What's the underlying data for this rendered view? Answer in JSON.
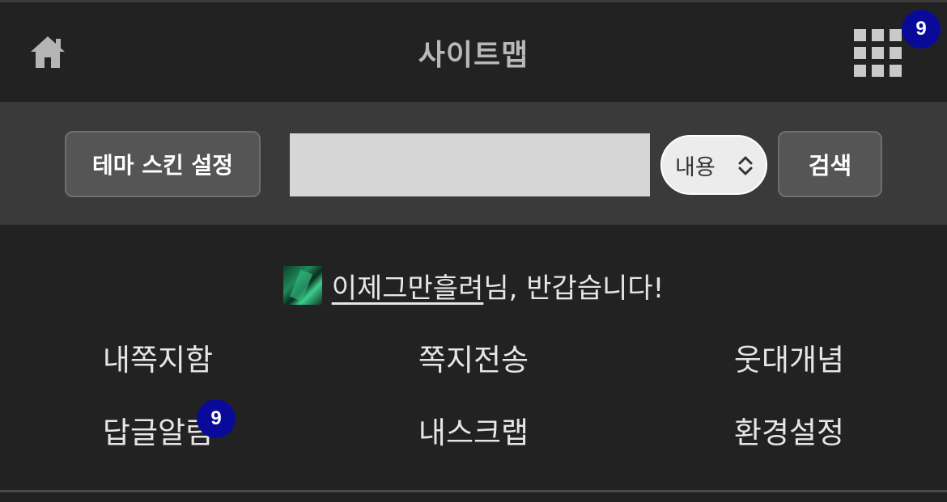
{
  "header": {
    "title": "사이트맵",
    "home_icon": "home-icon",
    "apps_icon": "grid-icon",
    "apps_badge": "9"
  },
  "searchbar": {
    "theme_button": "테마 스킨 설정",
    "input_value": "",
    "select_value": "내용",
    "search_button": "검색"
  },
  "greeting": {
    "username": "이제그만흘려",
    "suffix": "님, 반갑습니다!"
  },
  "menu": {
    "inbox": "내쪽지함",
    "send_message": "쪽지전송",
    "humor_concept": "웃대개념",
    "reply_alerts": "답글알림",
    "reply_alerts_badge": "9",
    "my_scrap": "내스크랩",
    "settings": "환경설정"
  },
  "colors": {
    "background": "#222222",
    "searchbar_bg": "#3a3a3a",
    "badge": "#0a0a9a"
  }
}
